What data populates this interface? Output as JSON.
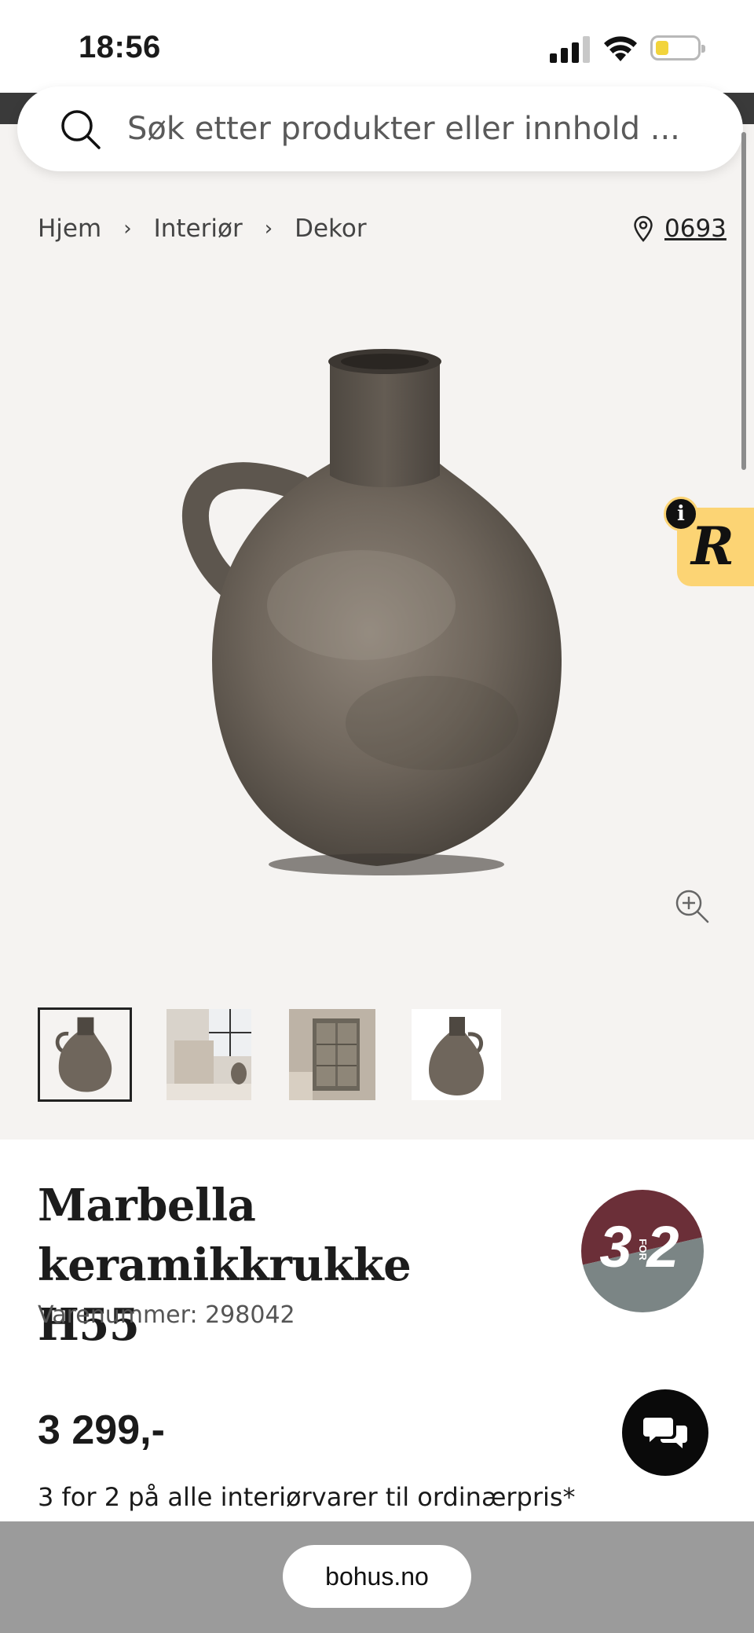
{
  "status_bar": {
    "time": "18:56",
    "icons": [
      "signal-icon",
      "wifi-icon",
      "battery-icon"
    ]
  },
  "search": {
    "placeholder": "Søk etter produkter eller innhold ...",
    "icon": "search-icon"
  },
  "breadcrumb": {
    "items": [
      {
        "label": "Hjem"
      },
      {
        "label": "Interiør"
      },
      {
        "label": "Dekor"
      }
    ],
    "separator": "›"
  },
  "store": {
    "icon": "location-pin-icon",
    "number": "0693"
  },
  "r_badge": {
    "letter": "R",
    "info": "i",
    "color": "#fcd474"
  },
  "thumbnails": [
    {
      "name": "vase-front",
      "active": true
    },
    {
      "name": "living-room-chair",
      "active": false
    },
    {
      "name": "shelf-cabinet",
      "active": false
    },
    {
      "name": "vase-side",
      "active": false
    }
  ],
  "product": {
    "title": "Marbella keramikkrukke H55",
    "sku_label": "Varenummer: ",
    "sku_value": "298042",
    "price": "3 299,-",
    "promo_text": "3 for 2 på alle interiørvarer til ordinærpris*"
  },
  "promo_badge": {
    "left": "3",
    "mid": "FOR",
    "right": "2",
    "color_top": "#6b2f38",
    "color_bottom": "#7b8585"
  },
  "chat": {
    "icon": "chat-bubbles-icon"
  },
  "browser": {
    "url": "bohus.no"
  },
  "colors": {
    "hero_background": "#f5f3f1",
    "browser_bar": "#9b9b9b"
  }
}
